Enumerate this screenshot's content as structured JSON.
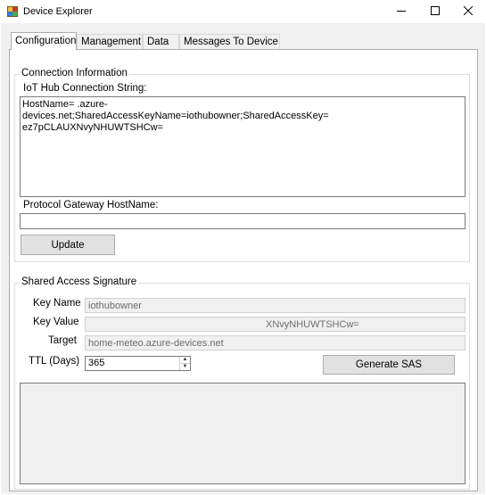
{
  "window": {
    "title": "Device Explorer",
    "controls": {
      "minimize": "minimize-icon",
      "maximize": "maximize-icon",
      "close": "close-icon"
    }
  },
  "tabs": [
    {
      "label": "Configuration",
      "active": true
    },
    {
      "label": "Management",
      "active": false
    },
    {
      "label": "Data",
      "active": false
    },
    {
      "label": "Messages To Device",
      "active": false
    }
  ],
  "connection": {
    "legend": "Connection Information",
    "conn_string_label": "IoT Hub Connection String:",
    "conn_string_lines": [
      "HostName=                        .azure-",
      "devices.net;SharedAccessKeyName=iothubowner;SharedAccessKey=",
      "ez7pCLAUXNvyNHUWTSHCw="
    ],
    "gateway_label": "Protocol Gateway HostName:",
    "gateway_value": "",
    "update_label": "Update"
  },
  "sas": {
    "legend": "Shared Access Signature",
    "key_name_label": "Key Name",
    "key_name_value": "iothubowner",
    "key_value_label": "Key Value",
    "key_value_value": "XNvyNHUWTSHCw=",
    "target_label": "Target",
    "target_value": "home-meteo.azure-devices.net",
    "ttl_label": "TTL (Days)",
    "ttl_value": "365",
    "generate_label": "Generate SAS",
    "output_value": ""
  }
}
